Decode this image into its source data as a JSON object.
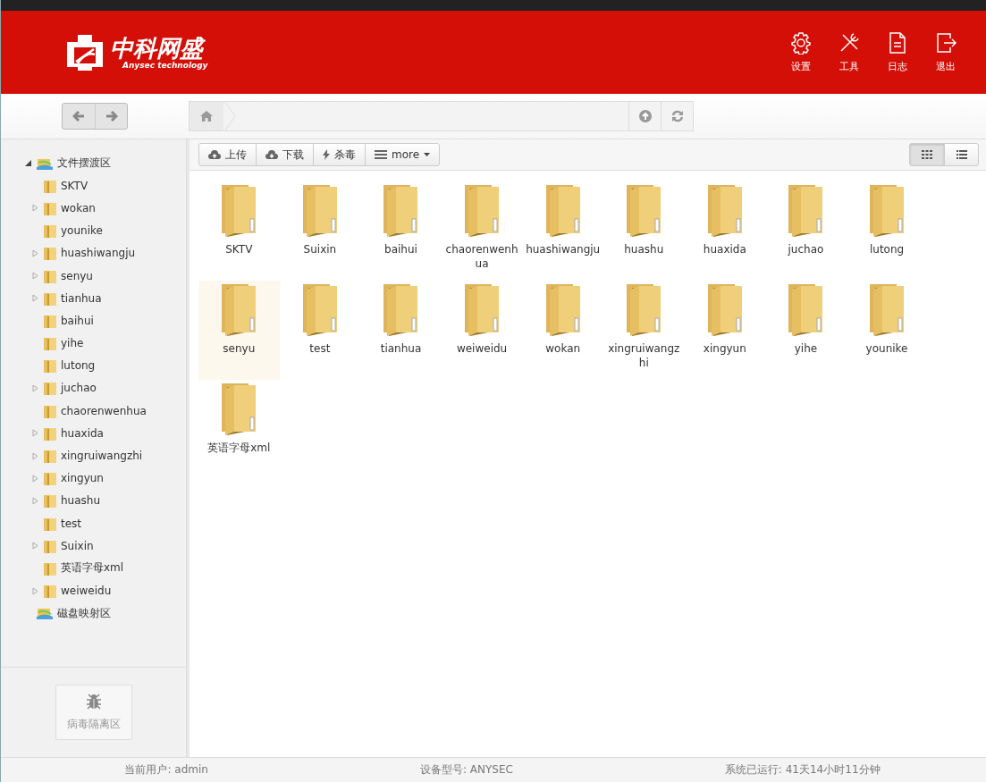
{
  "header": {
    "logo": {
      "name": "中科网盛",
      "tagline": "Anysec technology"
    },
    "actions": [
      {
        "kind": "gear",
        "label": "设置"
      },
      {
        "kind": "tools",
        "label": "工具"
      },
      {
        "kind": "document",
        "label": "日志"
      },
      {
        "kind": "exit",
        "label": "退出"
      }
    ]
  },
  "toolbar": {
    "actions": [
      {
        "kind": "upload",
        "label": "上传"
      },
      {
        "kind": "download",
        "label": "下载"
      },
      {
        "kind": "scan",
        "label": "杀毒"
      },
      {
        "kind": "more",
        "label": "more"
      }
    ],
    "views": [
      {
        "kind": "grid",
        "selected": true
      },
      {
        "kind": "list",
        "selected": false
      }
    ]
  },
  "sidebar": {
    "tree": [
      {
        "label": "文件摆渡区",
        "expandable": true,
        "expanded": true,
        "children": [
          {
            "label": "SKTV",
            "expandable": false
          },
          {
            "label": "wokan",
            "expandable": true
          },
          {
            "label": "younike",
            "expandable": false
          },
          {
            "label": "huashiwangju",
            "expandable": true
          },
          {
            "label": "senyu",
            "expandable": true
          },
          {
            "label": "tianhua",
            "expandable": true
          },
          {
            "label": "baihui",
            "expandable": false
          },
          {
            "label": "yihe",
            "expandable": false
          },
          {
            "label": "lutong",
            "expandable": false
          },
          {
            "label": "juchao",
            "expandable": true
          },
          {
            "label": "chaorenwenhua",
            "expandable": false
          },
          {
            "label": "huaxida",
            "expandable": true
          },
          {
            "label": "xingruiwangzhi",
            "expandable": true
          },
          {
            "label": "xingyun",
            "expandable": true
          },
          {
            "label": "huashu",
            "expandable": true
          },
          {
            "label": "test",
            "expandable": false
          },
          {
            "label": "Suixin",
            "expandable": true
          },
          {
            "label": "英语字母xml",
            "expandable": false
          },
          {
            "label": "weiweidu",
            "expandable": true
          }
        ]
      },
      {
        "label": "磁盘映射区",
        "expandable": false
      }
    ],
    "quarantine_button": "病毒隔离区"
  },
  "folders": [
    {
      "name": "SKTV",
      "selected": false
    },
    {
      "name": "Suixin",
      "selected": false
    },
    {
      "name": "baihui",
      "selected": false
    },
    {
      "name": "chaorenwenhua",
      "selected": false
    },
    {
      "name": "huashiwangju",
      "selected": false
    },
    {
      "name": "huashu",
      "selected": false
    },
    {
      "name": "huaxida",
      "selected": false
    },
    {
      "name": "juchao",
      "selected": false
    },
    {
      "name": "lutong",
      "selected": false
    },
    {
      "name": "senyu",
      "selected": true
    },
    {
      "name": "test",
      "selected": false
    },
    {
      "name": "tianhua",
      "selected": false
    },
    {
      "name": "weiweidu",
      "selected": false
    },
    {
      "name": "wokan",
      "selected": false
    },
    {
      "name": "xingruiwangzhi",
      "selected": false
    },
    {
      "name": "xingyun",
      "selected": false
    },
    {
      "name": "yihe",
      "selected": false
    },
    {
      "name": "younike",
      "selected": false
    },
    {
      "name": "英语字母xml",
      "selected": false
    }
  ],
  "status_bar": [
    "当前用户: admin",
    "设备型号: ANYSEC",
    "系统已运行: 41天14小时11分钟"
  ]
}
